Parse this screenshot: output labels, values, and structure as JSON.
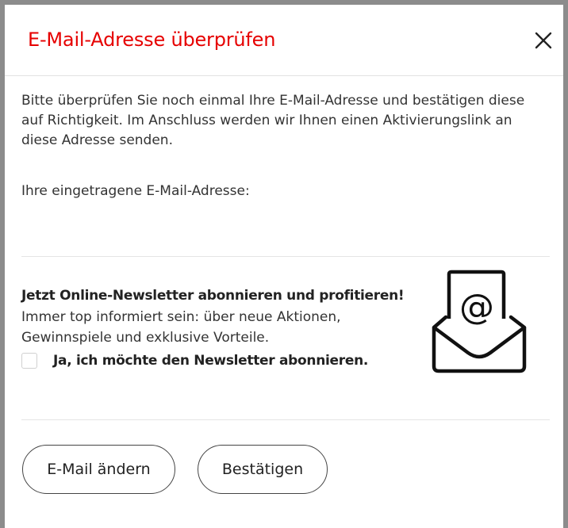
{
  "dialog": {
    "title": "E-Mail-Adresse überprüfen",
    "close_icon": "close-icon",
    "intro_text": "Bitte überprüfen Sie noch einmal Ihre E-Mail-Adresse und bestätigen diese auf Richtigkeit. Im Anschluss werden wir Ihnen einen Aktivierungslink an diese Adresse senden.",
    "email_label": "Ihre eingetragene E-Mail-Adresse:",
    "email_value": ""
  },
  "newsletter": {
    "heading": "Jetzt Online-Newsletter abonnieren und profitieren!",
    "description": "Immer top informiert sein: über neue Aktionen, Gewinnspiele und exklusive Vorteile.",
    "checkbox_label": "Ja, ich möchte den Newsletter abonnieren.",
    "checked": false,
    "icon": "envelope-at-icon"
  },
  "actions": {
    "change_label": "E-Mail ändern",
    "confirm_label": "Bestätigen"
  },
  "colors": {
    "accent": "#e60000",
    "backdrop": "#8c8c8c",
    "text": "#333333"
  }
}
